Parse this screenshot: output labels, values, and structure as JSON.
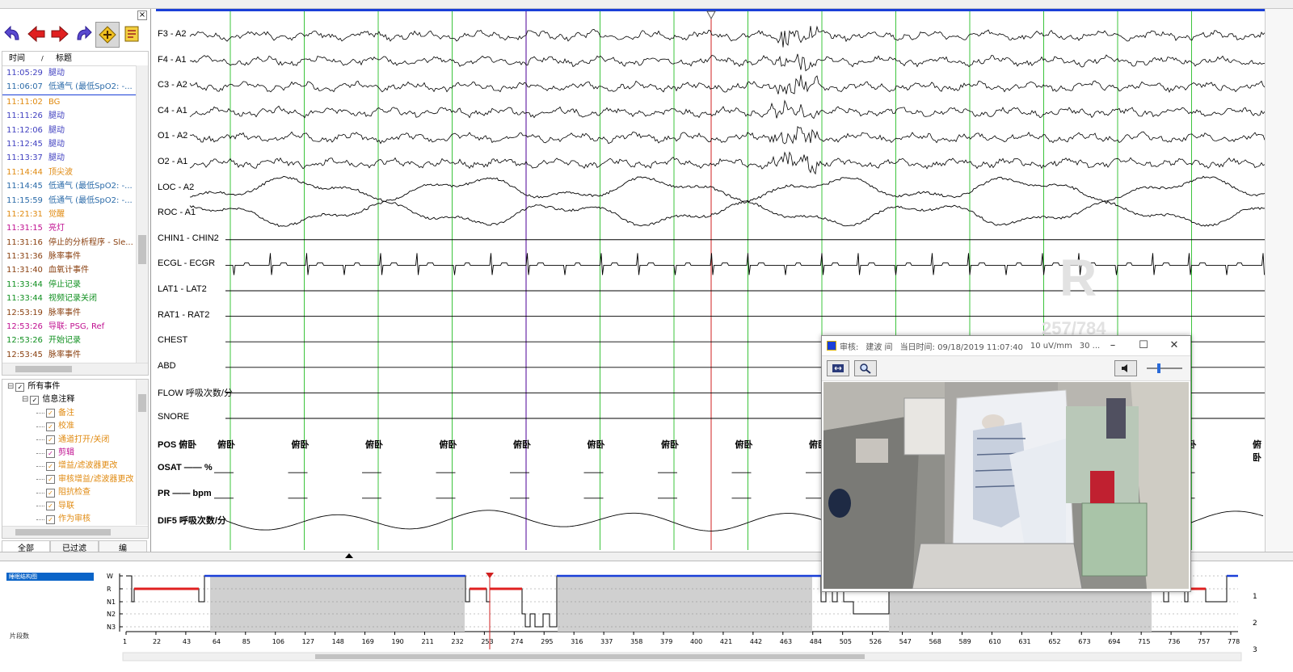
{
  "events": {
    "header": {
      "time": "时间",
      "title": "标题"
    },
    "rows": [
      {
        "time": "11:05:29",
        "label": "腿动",
        "color": "#4040c0"
      },
      {
        "time": "11:06:07",
        "label": "低通气 (最低SpO2: -...",
        "color": "#2a6aa8"
      },
      {
        "time": "11:11:02",
        "label": "BG",
        "color": "#e08a10"
      },
      {
        "time": "11:11:26",
        "label": "腿动",
        "color": "#4040c0"
      },
      {
        "time": "11:12:06",
        "label": "腿动",
        "color": "#4040c0"
      },
      {
        "time": "11:12:45",
        "label": "腿动",
        "color": "#4040c0"
      },
      {
        "time": "11:13:37",
        "label": "腿动",
        "color": "#4040c0"
      },
      {
        "time": "11:14:44",
        "label": "顶尖波",
        "color": "#e08a10"
      },
      {
        "time": "11:14:45",
        "label": "低通气 (最低SpO2: -...",
        "color": "#2a6aa8"
      },
      {
        "time": "11:15:59",
        "label": "低通气 (最低SpO2: -...",
        "color": "#2a6aa8"
      },
      {
        "time": "11:21:31",
        "label": "觉醒",
        "color": "#e08a10"
      },
      {
        "time": "11:31:15",
        "label": "亮灯",
        "color": "#c01090"
      },
      {
        "time": "11:31:16",
        "label": "停止的分析程序 - Sle...",
        "color": "#8a4010"
      },
      {
        "time": "11:31:36",
        "label": "脉率事件",
        "color": "#8a4010"
      },
      {
        "time": "11:31:40",
        "label": "血氧计事件",
        "color": "#8a4010"
      },
      {
        "time": "11:33:44",
        "label": "停止记录",
        "color": "#109020"
      },
      {
        "time": "11:33:44",
        "label": "视频记录关闭",
        "color": "#109020"
      },
      {
        "time": "12:53:19",
        "label": "脉率事件",
        "color": "#8a4010"
      },
      {
        "time": "12:53:26",
        "label": "导联: PSG, Ref",
        "color": "#c01090"
      },
      {
        "time": "12:53:26",
        "label": "开始记录",
        "color": "#109020"
      },
      {
        "time": "12:53:45",
        "label": "脉率事件",
        "color": "#8a4010"
      }
    ]
  },
  "tree": [
    {
      "label": "所有事件",
      "level": 0,
      "color": "#000000",
      "expander": "⊟"
    },
    {
      "label": "信息注释",
      "level": 1,
      "color": "#000000",
      "expander": "⊟"
    },
    {
      "label": "备注",
      "level": 2,
      "color": "#e08a10"
    },
    {
      "label": "校准",
      "level": 2,
      "color": "#e08a10"
    },
    {
      "label": "通道打开/关闭",
      "level": 2,
      "color": "#e08a10"
    },
    {
      "label": "剪辑",
      "level": 2,
      "color": "#c01090"
    },
    {
      "label": "增益/滤波器更改",
      "level": 2,
      "color": "#e08a10"
    },
    {
      "label": "审核增益/滤波器更改",
      "level": 2,
      "color": "#e08a10"
    },
    {
      "label": "阻抗检查",
      "level": 2,
      "color": "#e08a10"
    },
    {
      "label": "导联",
      "level": 2,
      "color": "#e08a10"
    },
    {
      "label": "作为审核",
      "level": 2,
      "color": "#e08a10"
    }
  ],
  "tabs": [
    "全部",
    "已过滤",
    "编"
  ],
  "channels": [
    {
      "label": "F3 - A2",
      "kind": "eeg"
    },
    {
      "label": "F4 - A1",
      "kind": "eeg"
    },
    {
      "label": "C3 - A2",
      "kind": "eeg"
    },
    {
      "label": "C4 - A1",
      "kind": "eeg"
    },
    {
      "label": "O1 - A2",
      "kind": "eeg"
    },
    {
      "label": "O2 - A1",
      "kind": "eeg"
    },
    {
      "label": "LOC - A2",
      "kind": "eog"
    },
    {
      "label": "ROC - A1",
      "kind": "eog"
    },
    {
      "label": "CHIN1 - CHIN2",
      "kind": "chin"
    },
    {
      "label": "ECGL - ECGR",
      "kind": "ecg"
    },
    {
      "label": "LAT1 - LAT2",
      "kind": "flat"
    },
    {
      "label": "RAT1 - RAT2",
      "kind": "flat"
    },
    {
      "label": "CHEST",
      "kind": "flat"
    },
    {
      "label": "ABD",
      "kind": "flat"
    },
    {
      "label": "FLOW 呼吸次数/分",
      "kind": "flat"
    },
    {
      "label": "SNORE",
      "kind": "flat"
    },
    {
      "label": "POS 俯卧",
      "kind": "pos"
    },
    {
      "label": "OSAT —— %",
      "kind": "dash"
    },
    {
      "label": "PR —— bpm",
      "kind": "dash"
    },
    {
      "label": "DIF5 呼吸次数/分",
      "kind": "slow"
    }
  ],
  "position_value": "俯卧",
  "watermark": {
    "letter": "R",
    "counter": "257/784"
  },
  "video": {
    "title_parts": [
      "审核:",
      "建波 间",
      "当日时间: 09/18/2019 11:07:40",
      "10 uV/mm",
      "30 ..."
    ]
  },
  "hypnogram": {
    "title": "睡眠结构图",
    "side_label": "片段数",
    "stage_labels": [
      "W",
      "R",
      "N1",
      "N2",
      "N3"
    ],
    "ticks": [
      "1",
      "22",
      "43",
      "64",
      "85",
      "106",
      "127",
      "148",
      "169",
      "190",
      "211",
      "232",
      "253",
      "274",
      "295",
      "316",
      "337",
      "358",
      "379",
      "400",
      "421",
      "442",
      "463",
      "484",
      "505",
      "526",
      "547",
      "568",
      "589",
      "610",
      "631",
      "652",
      "673",
      "694",
      "715",
      "736",
      "757",
      "778"
    ],
    "side_numbers": [
      "1",
      "2",
      "3"
    ]
  },
  "colors": {
    "accent_blue": "#1a3fd8",
    "grid_green": "#3cc43c",
    "cursor_red": "#d02020",
    "cursor_purple": "#6a2aa8",
    "rem_red": "#e02020",
    "selection_blue": "#0a64c8"
  }
}
